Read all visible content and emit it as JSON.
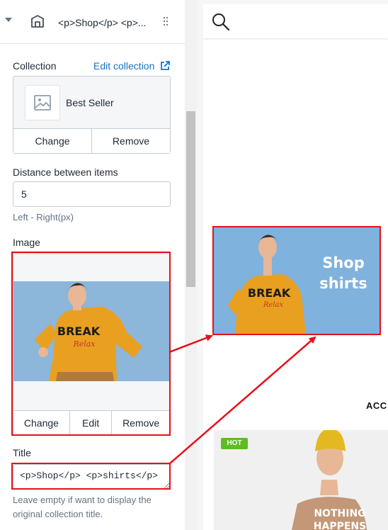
{
  "sidebar": {
    "section_title": "<p>Shop</p> <p>...",
    "collection": {
      "label": "Collection",
      "edit_link": "Edit collection",
      "name": "Best Seller",
      "change_label": "Change",
      "remove_label": "Remove"
    },
    "distance": {
      "label": "Distance between items",
      "value": "5",
      "help": "Left - Right(px)"
    },
    "image": {
      "label": "Image",
      "change_label": "Change",
      "edit_label": "Edit",
      "remove_label": "Remove"
    },
    "title": {
      "label": "Title",
      "value": "<p>Shop</p> <p>shirts</p>",
      "help_line1": "Leave empty if want to display the",
      "help_line2": "original collection title."
    }
  },
  "preview": {
    "banner_line1": "Shop",
    "banner_line2": "shirts",
    "section_heading": "ACC",
    "badge": "HOT",
    "sweater_text_1": "BREAK",
    "sweater_text_2": "Relax",
    "hoodie_text_1": "NOTHING",
    "hoodie_text_2": "HAPPENS"
  },
  "colors": {
    "highlight": "#e8101a",
    "link": "#1a73c4",
    "banner_bg": "#7fb2dd",
    "sweater": "#e9a020",
    "badge": "#5ebd22"
  }
}
